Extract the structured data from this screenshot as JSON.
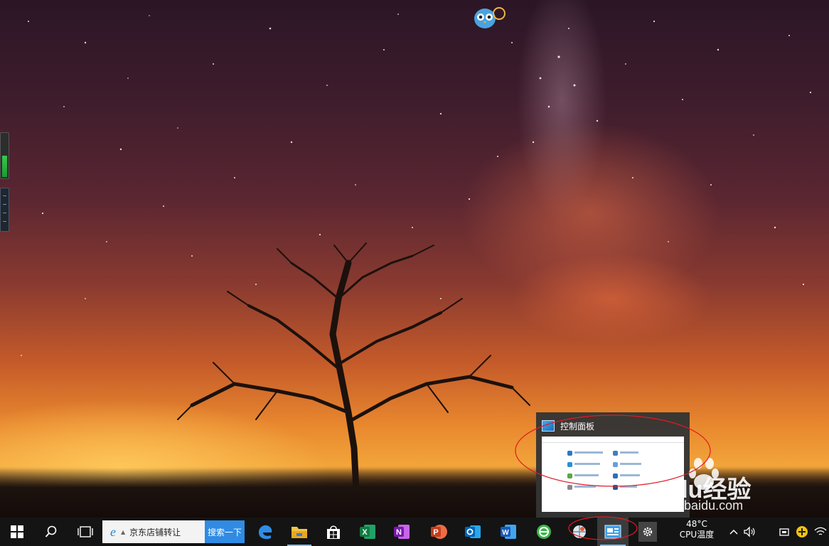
{
  "taskbar": {
    "search_text": "京东店铺转让",
    "search_button": "搜索一下",
    "tray": {
      "cpu_temp": "48°C",
      "cpu_temp_label": "CPU温度"
    }
  },
  "preview": {
    "title": "控制面板"
  },
  "watermark": {
    "logo_text": "Baidu经验",
    "url": "jingyan.baidu.com"
  },
  "icons": {
    "start": "windows-logo",
    "search": "magnifier",
    "task_view": "task-view",
    "pinned": [
      "edge",
      "file-explorer",
      "microsoft-store",
      "excel",
      "onenote",
      "powerpoint",
      "outlook",
      "word",
      "360-browser",
      "system-tool",
      "control-panel",
      "settings"
    ]
  },
  "colors": {
    "taskbar": "#141414",
    "search_button": "#2f8be3",
    "annotation": "#e01b24"
  }
}
